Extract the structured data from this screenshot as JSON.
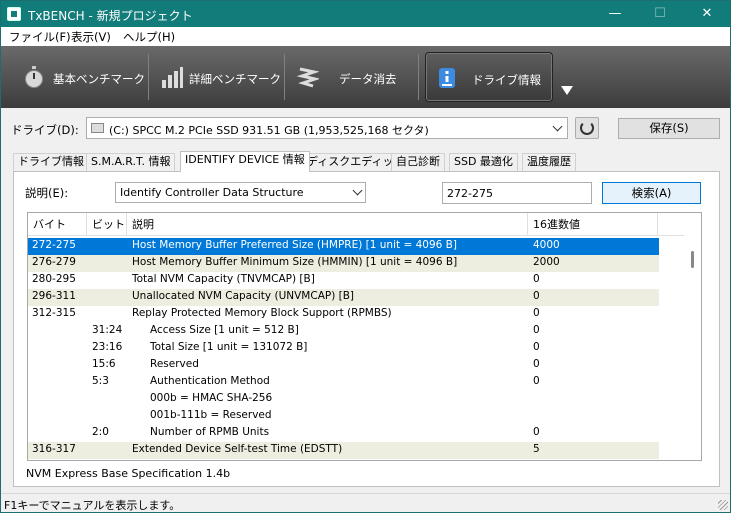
{
  "window": {
    "title": "TxBENCH - 新規プロジェクト"
  },
  "menu": [
    "ファイル(F)",
    "表示(V)",
    "ヘルプ(H)"
  ],
  "toolbar": {
    "buttons": [
      {
        "label": "基本ベンチマーク",
        "icon": "stopwatch-icon"
      },
      {
        "label": "詳細ベンチマーク",
        "icon": "bar-chart-icon"
      },
      {
        "label": "データ消去",
        "icon": "eraser-icon"
      },
      {
        "label": "ドライブ情報",
        "icon": "info-icon"
      }
    ],
    "more_icon": "triangle-down-icon"
  },
  "drive": {
    "label": "ドライブ(D):",
    "selected": "(C:) SPCC M.2 PCIe SSD  931.51 GB (1,953,525,168 セクタ)",
    "save_label": "保存(S)"
  },
  "tabs": [
    "ドライブ情報",
    "S.M.A.R.T. 情報",
    "IDENTIFY DEVICE 情報",
    "ディスクエディット",
    "自己診断",
    "SSD 最適化",
    "温度履歴"
  ],
  "explanation": {
    "label": "説明(E):",
    "selected": "Identify Controller Data Structure",
    "search_value": "272-275",
    "search_label": "検索(A)"
  },
  "table": {
    "columns": [
      "バイト",
      "ビット",
      "説明",
      "16進数値"
    ],
    "rows": [
      {
        "byte": "272-275",
        "bit": "",
        "desc": "Host Memory Buffer Preferred Size (HMPRE) [1 unit = 4096 B]",
        "hex": "4000",
        "indent": false,
        "style": "sel"
      },
      {
        "byte": "276-279",
        "bit": "",
        "desc": "Host Memory Buffer Minimum Size (HMMIN) [1 unit = 4096 B]",
        "hex": "2000",
        "indent": false,
        "style": "alt"
      },
      {
        "byte": "280-295",
        "bit": "",
        "desc": "Total NVM Capacity (TNVMCAP) [B]",
        "hex": "0",
        "indent": false,
        "style": ""
      },
      {
        "byte": "296-311",
        "bit": "",
        "desc": "Unallocated NVM Capacity (UNVMCAP) [B]",
        "hex": "0",
        "indent": false,
        "style": "alt"
      },
      {
        "byte": "312-315",
        "bit": "",
        "desc": "Replay Protected Memory Block Support (RPMBS)",
        "hex": "0",
        "indent": false,
        "style": ""
      },
      {
        "byte": "",
        "bit": "31:24",
        "desc": "Access Size [1 unit = 512 B]",
        "hex": "0",
        "indent": true,
        "style": ""
      },
      {
        "byte": "",
        "bit": "23:16",
        "desc": "Total Size [1 unit = 131072 B]",
        "hex": "0",
        "indent": true,
        "style": ""
      },
      {
        "byte": "",
        "bit": "15:6",
        "desc": "Reserved",
        "hex": "0",
        "indent": true,
        "style": ""
      },
      {
        "byte": "",
        "bit": "5:3",
        "desc": "Authentication Method",
        "hex": "0",
        "indent": true,
        "style": ""
      },
      {
        "byte": "",
        "bit": "",
        "desc": "000b = HMAC SHA-256",
        "hex": "",
        "indent": true,
        "style": ""
      },
      {
        "byte": "",
        "bit": "",
        "desc": "001b-111b = Reserved",
        "hex": "",
        "indent": true,
        "style": ""
      },
      {
        "byte": "",
        "bit": "2:0",
        "desc": "Number of RPMB Units",
        "hex": "0",
        "indent": true,
        "style": ""
      },
      {
        "byte": "316-317",
        "bit": "",
        "desc": "Extended Device Self-test Time (EDSTT)",
        "hex": "5",
        "indent": false,
        "style": "alt"
      }
    ]
  },
  "spec_text": "NVM Express Base Specification 1.4b",
  "status_text": "F1キーでマニュアルを表示します。",
  "colors": {
    "titlebar": "#127c7a",
    "selection": "#0078d7",
    "alt_row": "#eeeee0"
  }
}
